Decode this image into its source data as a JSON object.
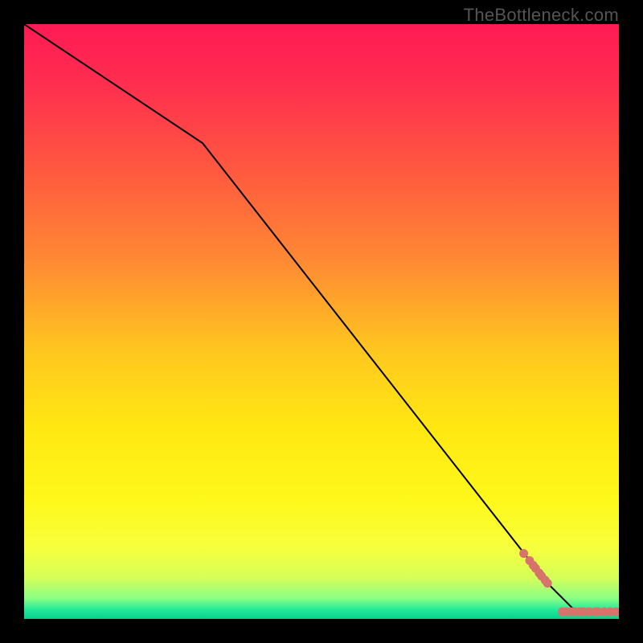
{
  "watermark": "TheBottleneck.com",
  "chart_data": {
    "type": "line",
    "title": "",
    "xlabel": "",
    "ylabel": "",
    "xlim": [
      0,
      100
    ],
    "ylim": [
      0,
      100
    ],
    "grid": false,
    "series": [
      {
        "name": "curve",
        "x": [
          0,
          30,
          88,
          93,
          100
        ],
        "y": [
          100,
          80,
          6,
          1,
          1
        ],
        "color": "#000000",
        "marker": "none"
      },
      {
        "name": "points-diagonal",
        "x": [
          84,
          85,
          85.6,
          86,
          86.6,
          87,
          87.6,
          88
        ],
        "y": [
          11,
          9.8,
          9.0,
          8.5,
          7.7,
          7.2,
          6.5,
          6.0
        ],
        "color": "#d6736b",
        "marker": "circle"
      },
      {
        "name": "points-flat",
        "x": [
          90.5,
          91.2,
          92.0,
          92.6,
          93.4,
          94.0,
          95.0,
          96.0,
          96.5,
          97.5,
          98.5,
          99.5
        ],
        "y": [
          1.2,
          1.2,
          1.2,
          1.2,
          1.2,
          1.2,
          1.2,
          1.2,
          1.2,
          1.2,
          1.2,
          1.2
        ],
        "color": "#d6736b",
        "marker": "circle"
      }
    ],
    "background_gradient": {
      "stops": [
        {
          "offset": 0.0,
          "color": "#ff1a54"
        },
        {
          "offset": 0.1,
          "color": "#ff2e4f"
        },
        {
          "offset": 0.25,
          "color": "#ff5a3f"
        },
        {
          "offset": 0.4,
          "color": "#ff8a33"
        },
        {
          "offset": 0.55,
          "color": "#ffc71f"
        },
        {
          "offset": 0.68,
          "color": "#ffe812"
        },
        {
          "offset": 0.8,
          "color": "#fff81a"
        },
        {
          "offset": 0.88,
          "color": "#f7ff3d"
        },
        {
          "offset": 0.93,
          "color": "#d6ff57"
        },
        {
          "offset": 0.965,
          "color": "#8cff85"
        },
        {
          "offset": 0.985,
          "color": "#20e99a"
        },
        {
          "offset": 1.0,
          "color": "#08cf8c"
        }
      ]
    }
  }
}
